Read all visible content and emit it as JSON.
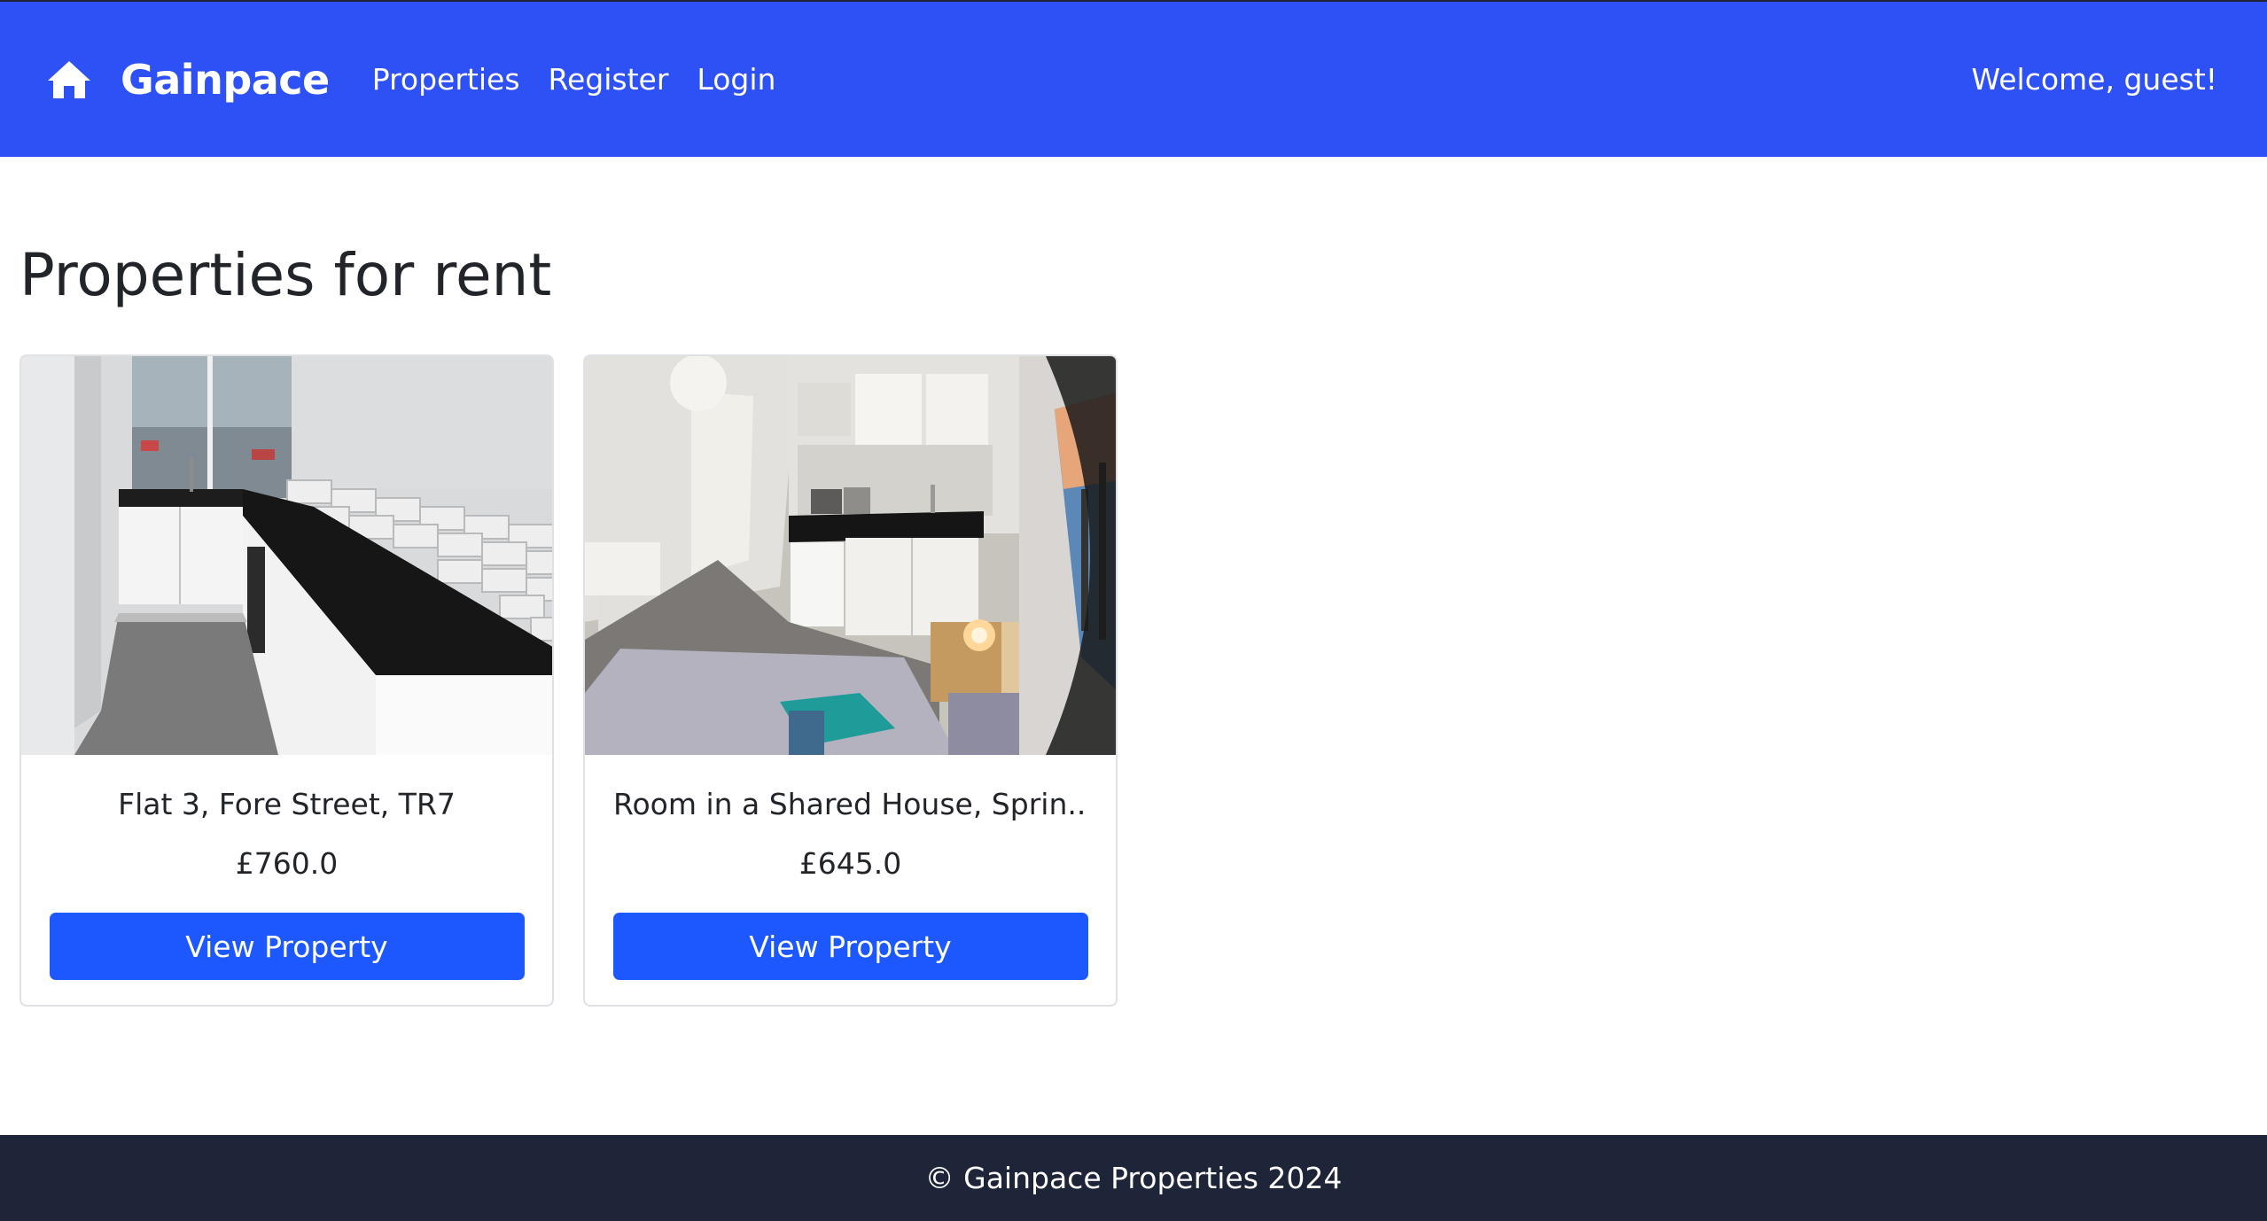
{
  "colors": {
    "navbar": "#2e51f5",
    "button": "#1d58ff",
    "footer": "#1f2538",
    "text": "#212529"
  },
  "navbar": {
    "brand_icon": "home-icon",
    "brand": "Gainpace",
    "links": [
      "Properties",
      "Register",
      "Login"
    ],
    "welcome": "Welcome, guest!"
  },
  "main": {
    "title": "Properties for rent",
    "properties": [
      {
        "title": "Flat 3, Fore Street, TR7",
        "price": "£760.0",
        "button": "View Property",
        "image": "kitchen-photo"
      },
      {
        "title": "Room in a Shared House, Sprin...",
        "price": "£645.0",
        "button": "View Property",
        "image": "room-photo"
      }
    ]
  },
  "footer": {
    "text": "© Gainpace Properties 2024"
  }
}
